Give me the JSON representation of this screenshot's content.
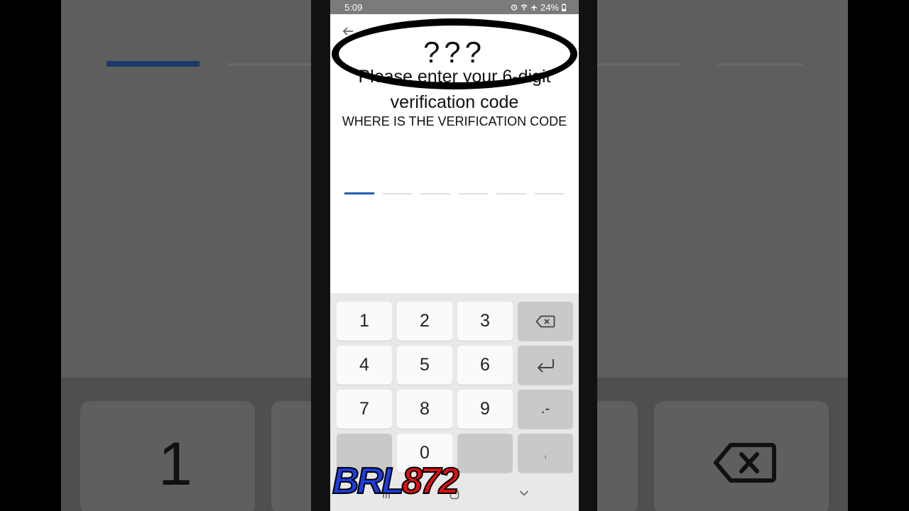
{
  "status_bar": {
    "time": "5:09",
    "battery": "24%",
    "icons": [
      "alarm-icon",
      "wifi-icon",
      "airplane-icon",
      "battery-icon"
    ]
  },
  "overlay": {
    "question_marks": "???"
  },
  "page": {
    "title": "Please enter your 6-digit verification code",
    "caption": "WHERE IS THE VERIFICATION CODE",
    "code_slots": 6,
    "active_slot": 0
  },
  "keypad": {
    "keys": [
      "1",
      "2",
      "3",
      "4",
      "5",
      "6",
      "7",
      "8",
      "9",
      "0"
    ],
    "dot_dash": ".-",
    "comma": ","
  },
  "background": {
    "key_label": "1"
  },
  "watermark": {
    "part1": "BRL",
    "part2": "872"
  },
  "colors": {
    "accent": "#1f5fb4",
    "status_bar": "#7b7b7b",
    "keyboard_bg": "#e8e8e8",
    "watermark_blue": "#1d3ce0",
    "watermark_red": "#e01010"
  }
}
